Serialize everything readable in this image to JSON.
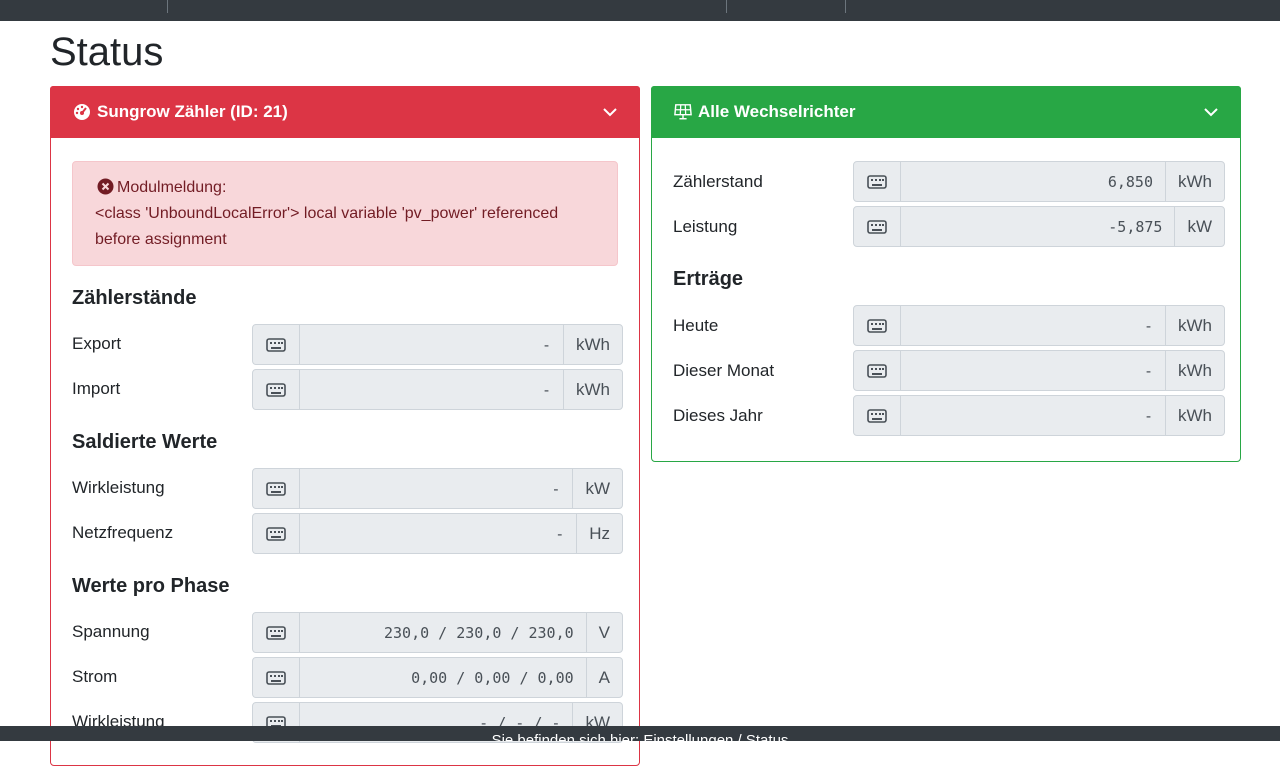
{
  "page": {
    "title": "Status"
  },
  "colors": {
    "danger": "#dc3545",
    "success": "#28a745",
    "navbar": "#343a40",
    "alert_bg": "#f8d7da"
  },
  "meter_card": {
    "title": "Sungrow Zähler (ID: 21)",
    "icon": "tachometer-icon",
    "alert": {
      "title": "Modulmeldung:",
      "message": "<class 'UnboundLocalError'> local variable 'pv_power' referenced before assignment"
    },
    "sections": [
      {
        "title": "Zählerstände",
        "rows": [
          {
            "label": "Export",
            "value": "-",
            "unit": "kWh"
          },
          {
            "label": "Import",
            "value": "-",
            "unit": "kWh"
          }
        ]
      },
      {
        "title": "Saldierte Werte",
        "rows": [
          {
            "label": "Wirkleistung",
            "value": "-",
            "unit": "kW"
          },
          {
            "label": "Netzfrequenz",
            "value": "-",
            "unit": "Hz"
          }
        ]
      },
      {
        "title": "Werte pro Phase",
        "rows": [
          {
            "label": "Spannung",
            "value": "230,0 / 230,0 / 230,0",
            "unit": "V"
          },
          {
            "label": "Strom",
            "value": "0,00 / 0,00 / 0,00",
            "unit": "A"
          },
          {
            "label": "Wirkleistung",
            "value": "- / - / -",
            "unit": "kW"
          }
        ]
      }
    ]
  },
  "inverter_card": {
    "title": "Alle Wechselrichter",
    "icon": "solar-panel-icon",
    "rows": [
      {
        "label": "Zählerstand",
        "value": "6,850",
        "unit": "kWh"
      },
      {
        "label": "Leistung",
        "value": "-5,875",
        "unit": "kW"
      }
    ],
    "yields_title": "Erträge",
    "yields": [
      {
        "label": "Heute",
        "value": "-",
        "unit": "kWh"
      },
      {
        "label": "Dieser Monat",
        "value": "-",
        "unit": "kWh"
      },
      {
        "label": "Dieses Jahr",
        "value": "-",
        "unit": "kWh"
      }
    ]
  },
  "footer": {
    "text": "Sie befinden sich hier: Einstellungen / Status"
  }
}
